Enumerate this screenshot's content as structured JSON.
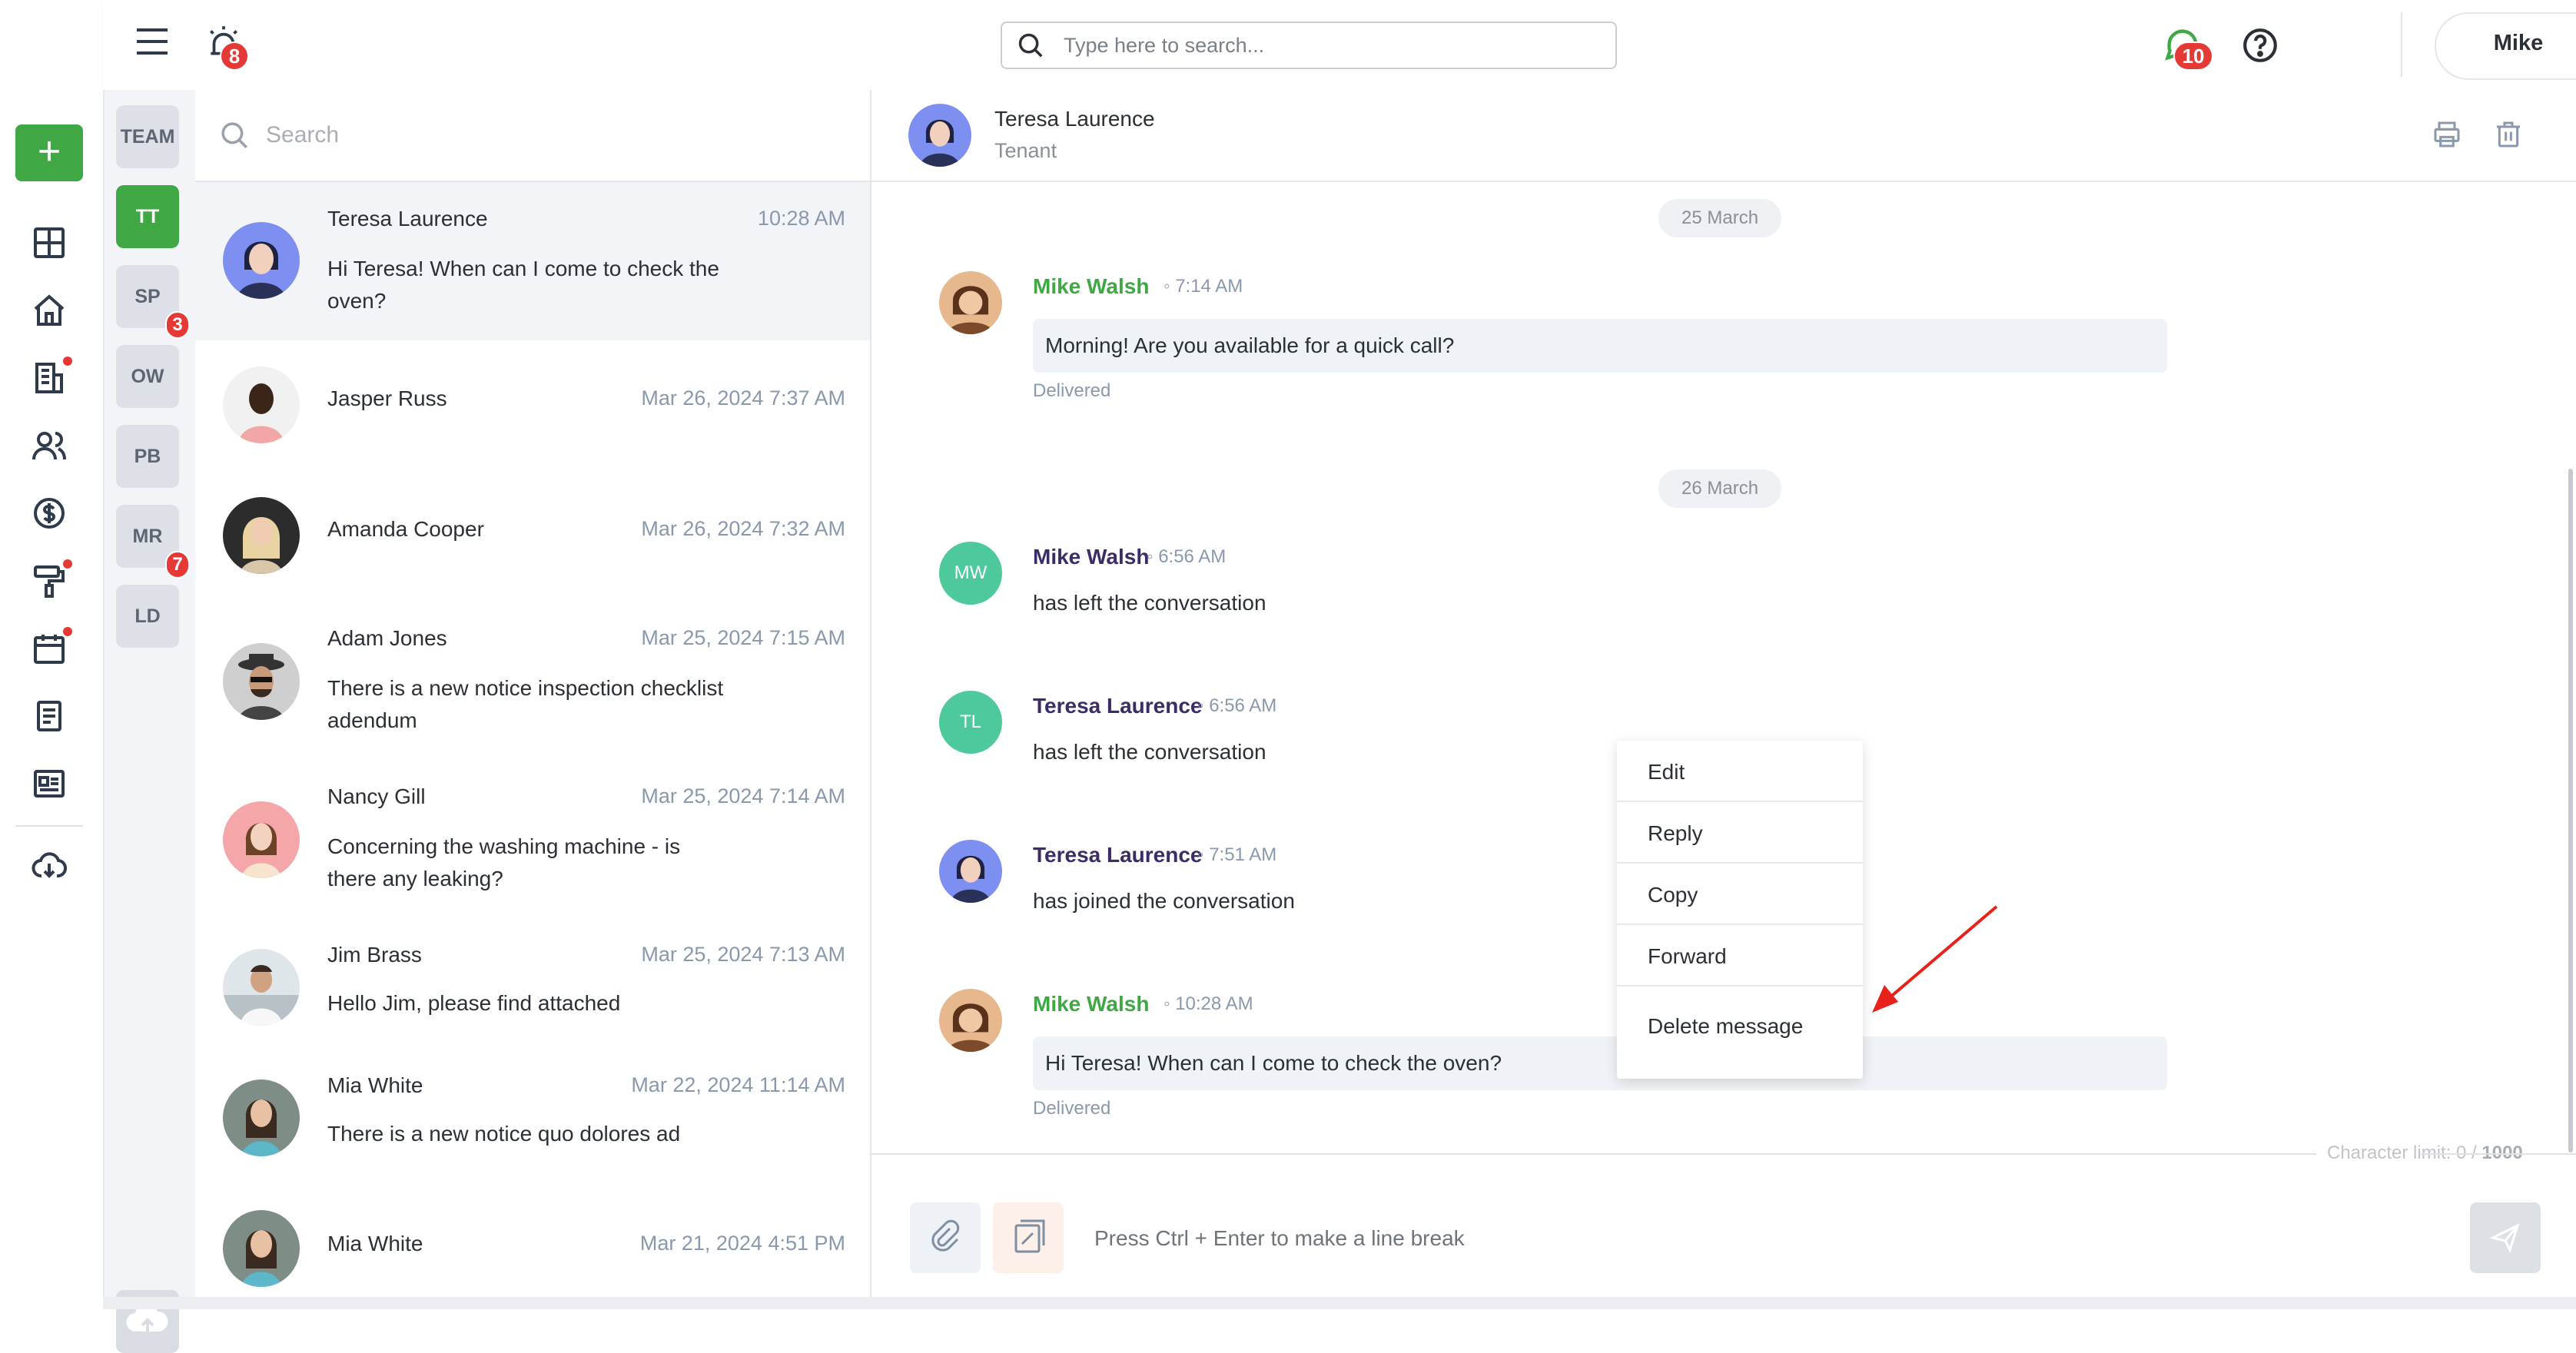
{
  "topbar": {
    "alarm_badge": "8",
    "search_placeholder": "Type here to search...",
    "chat_badge": "10",
    "user_name": "Mike"
  },
  "groups": [
    {
      "label": "TEAM",
      "badge": ""
    },
    {
      "label": "TT",
      "badge": ""
    },
    {
      "label": "SP",
      "badge": "3"
    },
    {
      "label": "OW",
      "badge": ""
    },
    {
      "label": "PB",
      "badge": ""
    },
    {
      "label": "MR",
      "badge": "7"
    },
    {
      "label": "LD",
      "badge": ""
    }
  ],
  "conversation_list": {
    "search_placeholder": "Search",
    "items": [
      {
        "name": "Teresa Laurence",
        "time": "10:28 AM",
        "preview": "Hi Teresa! When can I come to check the oven?"
      },
      {
        "name": "Jasper Russ",
        "time": "Mar 26, 2024 7:37 AM",
        "preview": ""
      },
      {
        "name": "Amanda Cooper",
        "time": "Mar 26, 2024 7:32 AM",
        "preview": ""
      },
      {
        "name": "Adam Jones",
        "time": "Mar 25, 2024 7:15 AM",
        "preview": "There is a new notice inspection checklist adendum"
      },
      {
        "name": "Nancy Gill",
        "time": "Mar 25, 2024 7:14 AM",
        "preview": "Concerning the washing machine - is there any leaking?"
      },
      {
        "name": "Jim Brass",
        "time": "Mar 25, 2024 7:13 AM",
        "preview": "Hello Jim, please find attached"
      },
      {
        "name": "Mia White",
        "time": "Mar 22, 2024 11:14 AM",
        "preview": "There is a new notice quo dolores ad"
      },
      {
        "name": "Mia White",
        "time": "Mar 21, 2024 4:51 PM",
        "preview": ""
      }
    ]
  },
  "chat": {
    "header": {
      "name": "Teresa Laurence",
      "subtitle": "Tenant"
    },
    "date_1": "25 March",
    "date_2": "26 March",
    "messages": [
      {
        "author": "Mike Walsh",
        "time": "7:14 AM",
        "text": "Morning! Are you available for a quick call?",
        "status": "Delivered"
      },
      {
        "author": "Mike Walsh",
        "initials": "MW",
        "time": "6:56 AM",
        "text": "has left the conversation"
      },
      {
        "author": "Teresa Laurence",
        "initials": "TL",
        "time": "6:56 AM",
        "text": "has left the conversation"
      },
      {
        "author": "Teresa Laurence",
        "time": "7:51 AM",
        "text": "has joined the conversation"
      },
      {
        "author": "Mike Walsh",
        "time": "10:28 AM",
        "text": "Hi Teresa! When can I come to check the oven?",
        "status": "Delivered"
      }
    ],
    "context_menu": [
      "Edit",
      "Reply",
      "Copy",
      "Forward",
      "Delete message"
    ],
    "char_limit_label": "Character limit: 0 /",
    "char_limit_max": "1000",
    "composer_placeholder": "Press Ctrl + Enter to make a line break"
  },
  "colors": {
    "accent_green": "#3fa845",
    "badge_red": "#e53935",
    "author_purple": "#3e2c66",
    "annotation_red": "#e8221b"
  }
}
